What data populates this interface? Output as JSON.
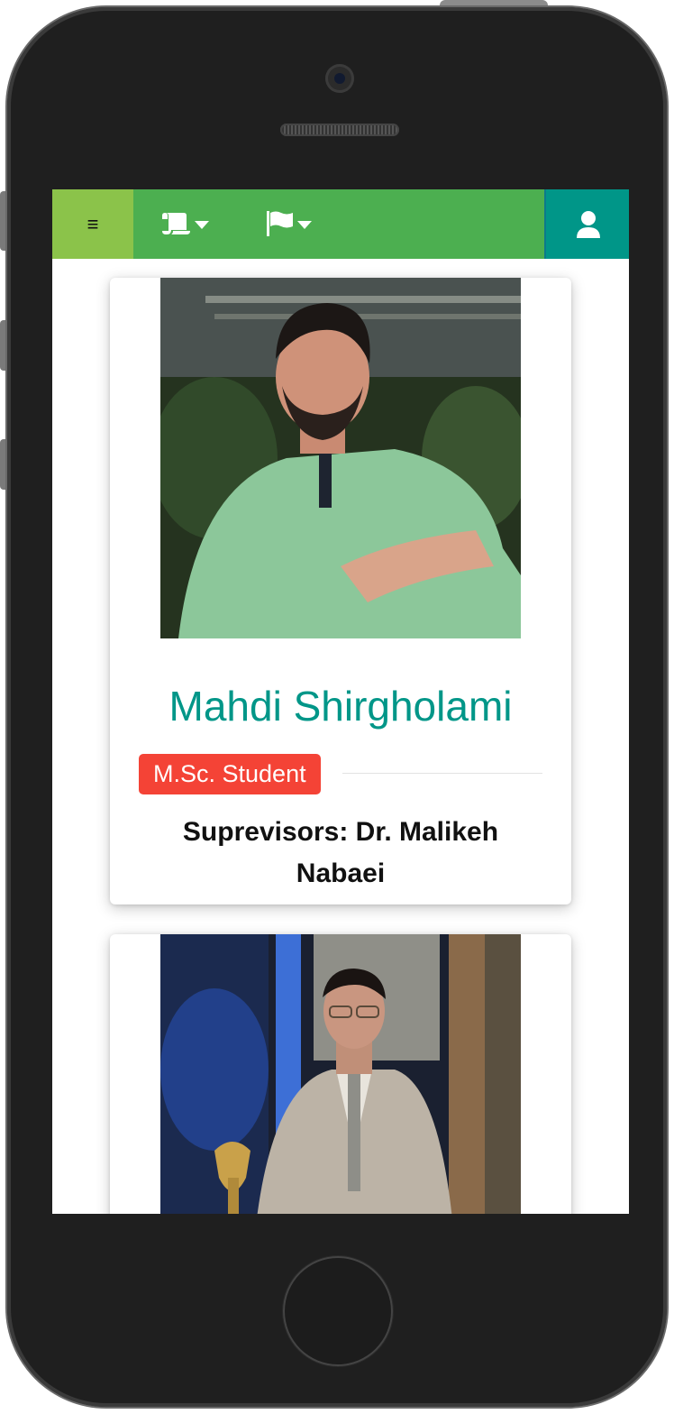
{
  "navbar": {
    "menu_icon": "hamburger-icon",
    "items": [
      {
        "icon": "scroll-icon",
        "dropdown": true
      },
      {
        "icon": "flag-icon",
        "dropdown": true
      }
    ],
    "user_icon": "user-icon",
    "menu_label": "≡"
  },
  "colors": {
    "navbar": "#4caf50",
    "menu_button": "#8bc34a",
    "user_button": "#009688",
    "name_text": "#009688",
    "badge": "#f44336"
  },
  "people": [
    {
      "name": "Mahdi Shirgholami",
      "role": "M.Sc. Student",
      "supervisors": "Suprevisors: Dr. Malikeh Nabaei"
    },
    {
      "name": "",
      "role": "",
      "supervisors": ""
    }
  ]
}
